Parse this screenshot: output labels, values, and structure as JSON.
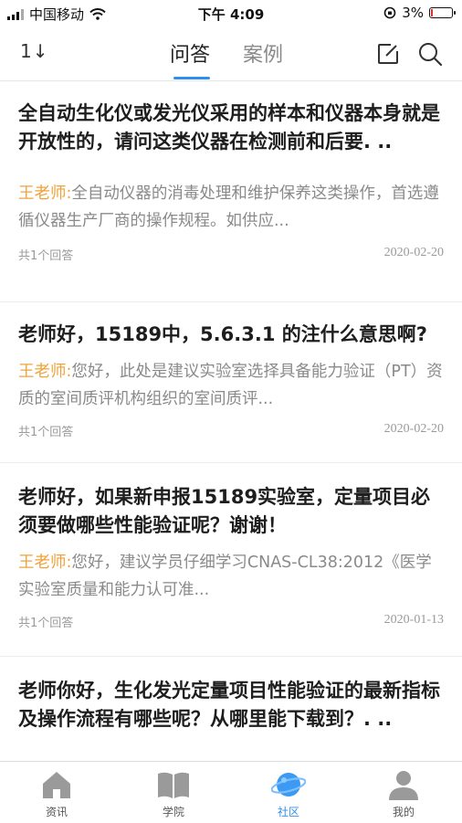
{
  "status_bar": {
    "carrier": "中国移动",
    "time": "下午 4:09",
    "battery": "3%"
  },
  "nav": {
    "sort_label": "1↓",
    "tabs": [
      {
        "label": "问答",
        "active": true
      },
      {
        "label": "案例",
        "active": false
      }
    ],
    "icons": [
      "edit-icon",
      "search-icon"
    ],
    "accent_color": "#2f8ff0"
  },
  "feed": [
    {
      "title": "全自动生化仪或发光仪采用的样本和仪器本身就是开放性的，请问这类仪器在检测前和后要. ..",
      "teacher": "王老师:",
      "answer": "全自动仪器的消毒处理和维护保养这类操作，首选遵循仪器生产厂商的操作规程。如供应...",
      "count": "共1个回答",
      "date": "2020-02-20"
    },
    {
      "title": "老师好，15189中，5.6.3.1 的注什么意思啊?",
      "teacher": "王老师:",
      "answer": "您好，此处是建议实验室选择具备能力验证（PT）资质的室间质评机构组织的室间质评...",
      "count": "共1个回答",
      "date": "2020-02-20"
    },
    {
      "title": "老师好，如果新申报15189实验室，定量项目必须要做哪些性能验证呢？谢谢！",
      "teacher": "王老师:",
      "answer": "您好，建议学员仔细学习CNAS-CL38:2012《医学实验室质量和能力认可准...",
      "count": "共1个回答",
      "date": "2020-01-13"
    },
    {
      "title": "老师你好，生化发光定量项目性能验证的最新指标及操作流程有哪些呢？从哪里能下载到？. ..",
      "teacher": "",
      "answer": "",
      "count": "",
      "date": ""
    }
  ],
  "tabbar": {
    "items": [
      {
        "label": "资讯",
        "icon": "home-icon",
        "active": false
      },
      {
        "label": "学院",
        "icon": "book-icon",
        "active": false
      },
      {
        "label": "社区",
        "icon": "planet-icon",
        "active": true
      },
      {
        "label": "我的",
        "icon": "user-icon",
        "active": false
      }
    ]
  }
}
